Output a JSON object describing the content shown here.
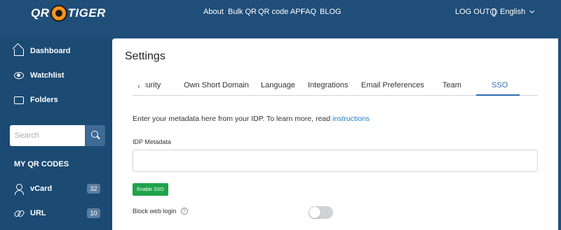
{
  "header": {
    "logo_left": "QR",
    "logo_right": "TIGER",
    "nav": [
      "About",
      "Bulk QR",
      "QR code API",
      "FAQ",
      "BLOG"
    ],
    "logout": "LOG OUT",
    "language": "English"
  },
  "sidebar": {
    "items": [
      {
        "label": "Dashboard",
        "icon": "home-icon"
      },
      {
        "label": "Watchlist",
        "icon": "eye-icon"
      },
      {
        "label": "Folders",
        "icon": "folder-icon"
      }
    ],
    "search": {
      "placeholder": "Search"
    },
    "section_title": "MY QR CODES",
    "codes": [
      {
        "label": "vCard",
        "count": "32",
        "icon": "user-icon"
      },
      {
        "label": "URL",
        "count": "10",
        "icon": "link-icon"
      }
    ]
  },
  "main": {
    "title": "Settings",
    "tabs": [
      "curity",
      "Own Short Domain",
      "Language",
      "Integrations",
      "Email Preferences",
      "Team",
      "SSO"
    ],
    "active_tab": "SSO",
    "intro_text": "Enter your metadata here from your IDP. To learn more, read",
    "intro_link": "instructions",
    "idp_label": "IDP Metadata",
    "idp_value": "",
    "enable_button": "Enable SSO",
    "block_web_login_label": "Block web login",
    "block_web_login_enabled": false
  },
  "colors": {
    "brand_bg": "#1f4e79",
    "accent": "#2f6cb3",
    "success": "#1fa34a"
  }
}
